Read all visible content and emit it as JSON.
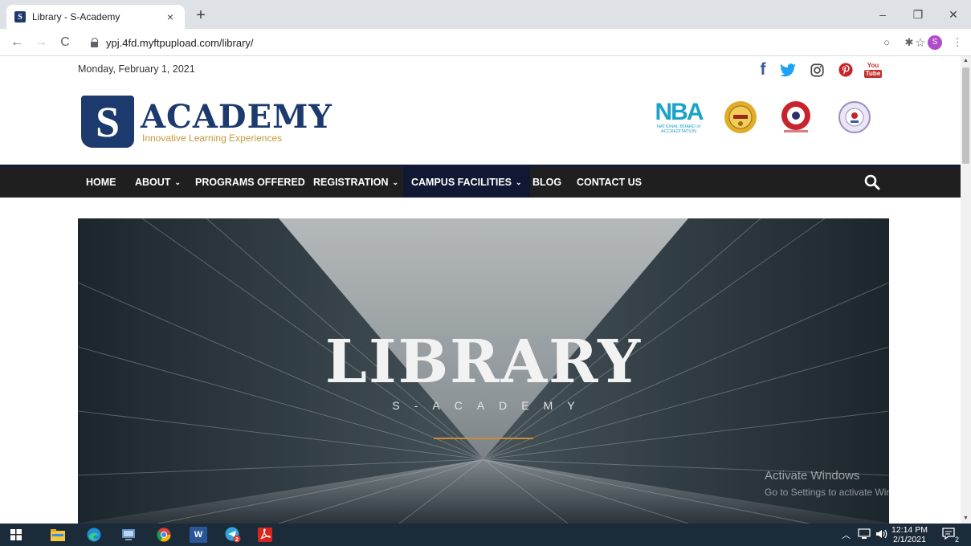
{
  "browser": {
    "tab_title": "Library - S-Academy",
    "tab_favicon_letter": "S",
    "tab_close": "×",
    "new_tab": "+",
    "url": "ypj.4fd.myftpupload.com/library/",
    "profile_initial": "S",
    "window_controls": {
      "minimize": "–",
      "restore": "❐",
      "close": "✕"
    }
  },
  "page": {
    "date": "Monday, February 1, 2021",
    "social": [
      {
        "name": "facebook-icon",
        "glyph": "f",
        "color": "#3b5998"
      },
      {
        "name": "twitter-icon",
        "glyph": "🐦",
        "color": "#1da1f2"
      },
      {
        "name": "instagram-icon",
        "glyph": "◎",
        "color": "#444444"
      },
      {
        "name": "pinterest-icon",
        "glyph": "P",
        "color": "#cb2027"
      },
      {
        "name": "youtube-icon",
        "glyph": "You Tube",
        "color": "#c4302b"
      }
    ],
    "logo": {
      "letter": "S",
      "brand": "ACADEMY",
      "tagline": "Innovative Learning Experiences"
    },
    "accreditation": {
      "nba_mark": "NBA",
      "nba_sub": "NATIONAL BOARD of ACCREDITATION",
      "seal_colors": [
        "#d9a520",
        "#c8232c",
        "#9c8ec4"
      ]
    },
    "nav": [
      {
        "label": "HOME",
        "dropdown": false,
        "active": false
      },
      {
        "label": "ABOUT",
        "dropdown": true,
        "active": false
      },
      {
        "label": "PROGRAMS OFFERED",
        "dropdown": false,
        "active": false
      },
      {
        "label": "REGISTRATION",
        "dropdown": true,
        "active": false
      },
      {
        "label": "CAMPUS FACILITIES",
        "dropdown": true,
        "active": true
      },
      {
        "label": "BLOG",
        "dropdown": false,
        "active": false
      },
      {
        "label": "CONTACT US",
        "dropdown": false,
        "active": false
      }
    ],
    "hero": {
      "title": "LIBRARY",
      "subtitle": "S-ACADEMY"
    },
    "watermark": {
      "line1": "Activate Windows",
      "line2": "Go to Settings to activate Windows."
    }
  },
  "taskbar": {
    "time": "12:14 PM",
    "date": "2/1/2021",
    "notifications": "2",
    "telegram_badge": "2"
  },
  "colors": {
    "brand_navy": "#1d3a6e",
    "tagline_gold": "#c49a3a",
    "nav_bg": "#1f1f1f",
    "nav_active": "#101834",
    "hero_rule": "#c98d3a"
  }
}
